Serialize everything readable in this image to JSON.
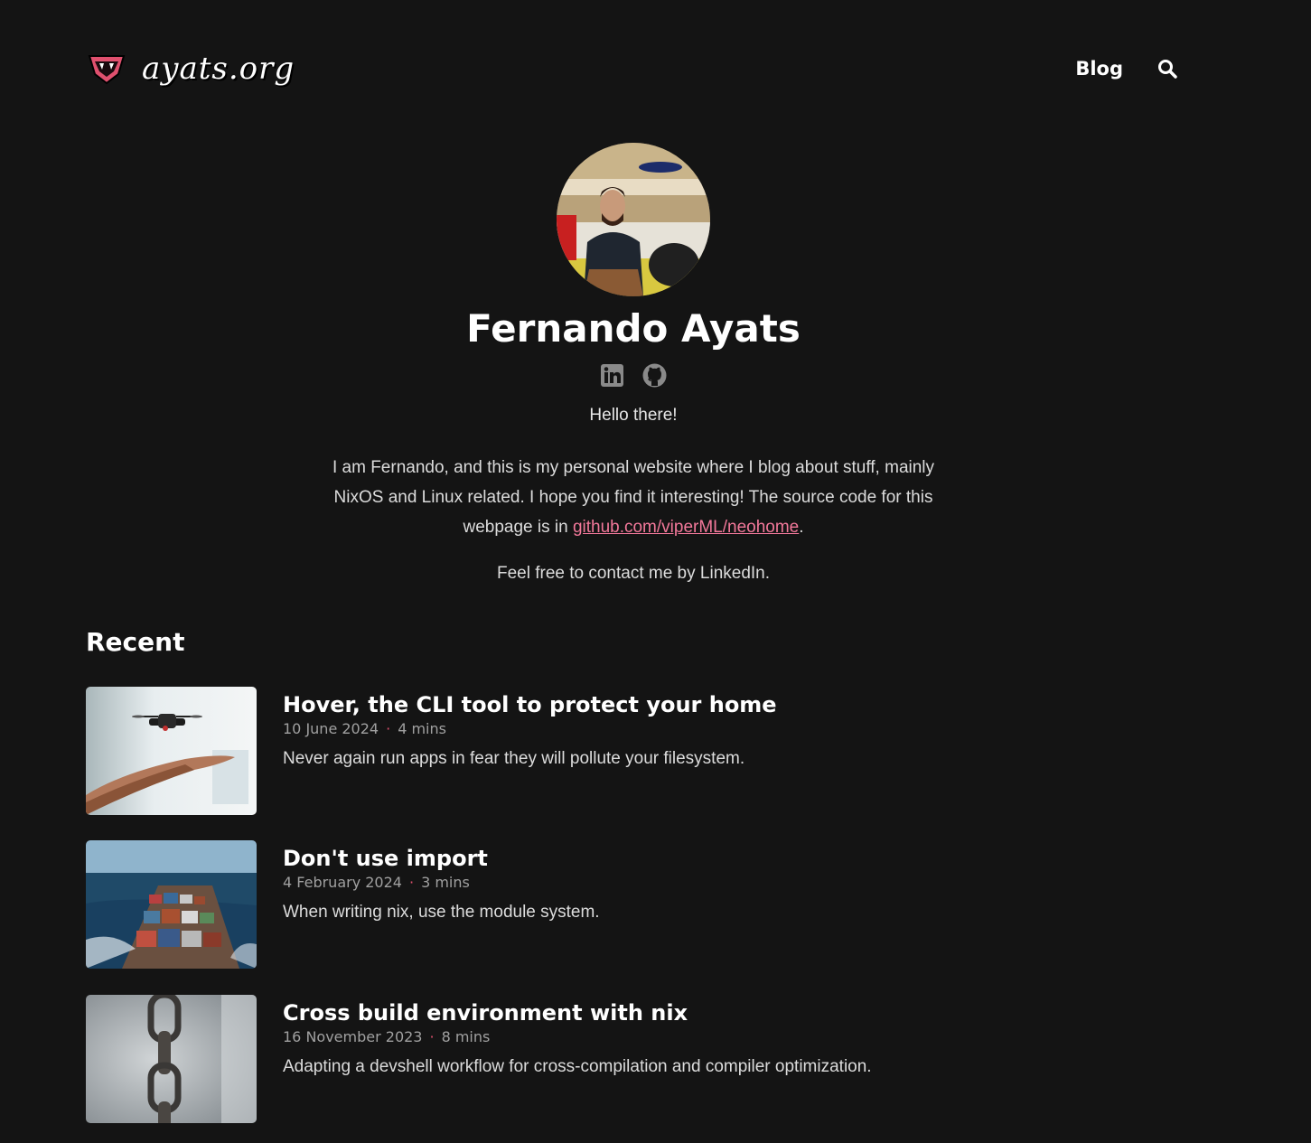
{
  "header": {
    "logo_text": "ayats.org",
    "nav": {
      "blog_label": "Blog"
    }
  },
  "profile": {
    "name": "Fernando Ayats",
    "hello": "Hello there!",
    "intro_text": "I am Fernando, and this is my personal website where I blog about stuff, mainly NixOS and Linux related. I hope you find it interesting! The source code for this webpage is in ",
    "intro_link": "github.com/viperML/neohome",
    "intro_end": ".",
    "contact": "Feel free to contact me by LinkedIn."
  },
  "recent": {
    "title": "Recent",
    "posts": [
      {
        "title": "Hover, the CLI tool to protect your home",
        "date": "10 June 2024",
        "read_time": "4 mins",
        "description": "Never again run apps in fear they will pollute your filesystem."
      },
      {
        "title": "Don't use import",
        "date": "4 February 2024",
        "read_time": "3 mins",
        "description": "When writing nix, use the module system."
      },
      {
        "title": "Cross build environment with nix",
        "date": "16 November 2023",
        "read_time": "8 mins",
        "description": "Adapting a devshell workflow for cross-compilation and compiler optimization."
      }
    ]
  },
  "colors": {
    "background": "#141414",
    "link": "#f2789a",
    "accent": "#e0506e"
  },
  "icons": [
    "viper-logo-icon",
    "search-icon",
    "linkedin-icon",
    "github-icon"
  ]
}
